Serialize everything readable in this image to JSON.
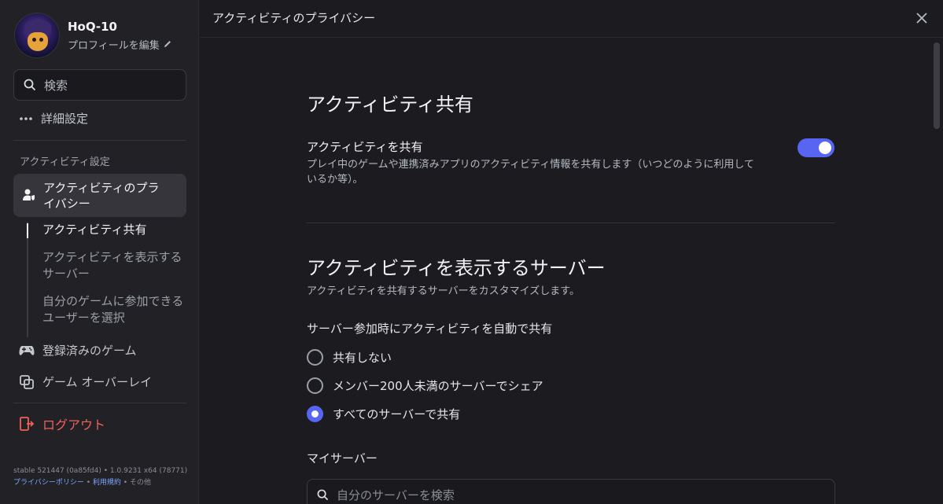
{
  "profile": {
    "username": "HoQ-10",
    "edit_label": "プロフィールを編集"
  },
  "sidebar": {
    "search_label": "検索",
    "advanced_label": "詳細設定",
    "section_label": "アクティビティ設定",
    "active_item": "アクティビティのプライバシー",
    "subitems": [
      "アクティビティ共有",
      "アクティビティを表示するサーバー",
      "自分のゲームに参加できるユーザーを選択"
    ],
    "registered_games": "登録済みのゲーム",
    "game_overlay": "ゲーム オーバーレイ",
    "logout": "ログアウト",
    "build": "stable 521447 (0a85fd4) • 1.0.9231 x64 (78771)",
    "privacy_policy": "プライバシーポリシー",
    "terms": "利用規約",
    "other": "その他"
  },
  "main": {
    "page_title": "アクティビティのプライバシー",
    "section1_title": "アクティビティ共有",
    "share_title": "アクティビティを共有",
    "share_desc": "プレイ中のゲームや連携済みアプリのアクティビティ情報を共有します（いつどのように利用しているか等）。",
    "share_enabled": true,
    "section2_title": "アクティビティを表示するサーバー",
    "section2_desc": "アクティビティを共有するサーバーをカスタマイズします。",
    "auto_share_label": "サーバー参加時にアクティビティを自動で共有",
    "options": [
      "共有しない",
      "メンバー200人未満のサーバーでシェア",
      "すべてのサーバーで共有"
    ],
    "selected_option": "すべてのサーバーで共有",
    "my_servers_label": "マイサーバー",
    "server_search_placeholder": "自分のサーバーを検索"
  },
  "colors": {
    "accent": "#5865f2",
    "logout": "#f0605a",
    "link": "#7aa7ff"
  }
}
